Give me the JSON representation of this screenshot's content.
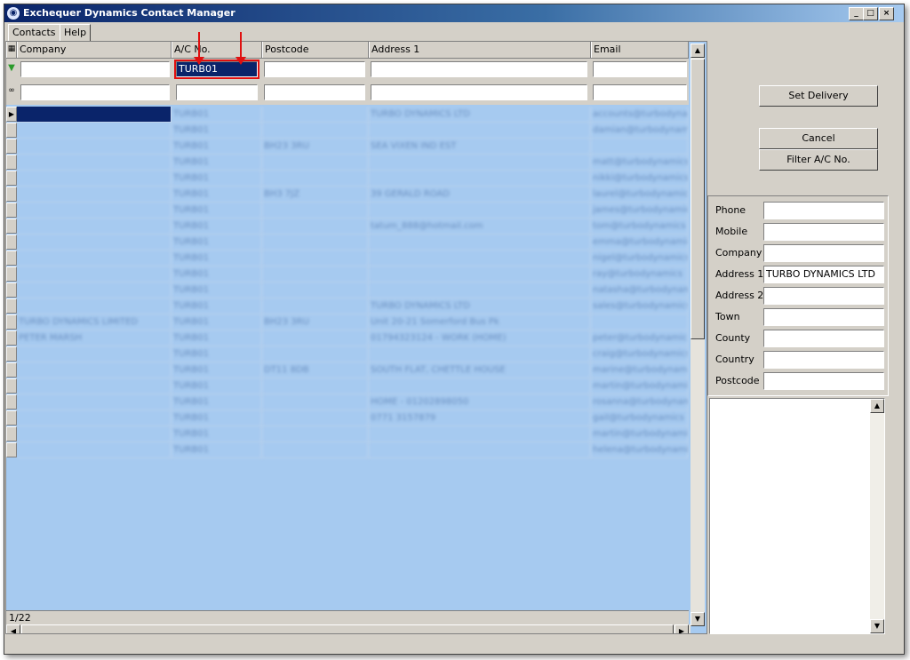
{
  "window": {
    "title": "Exchequer Dynamics Contact Manager",
    "min_glyph": "_",
    "max_glyph": "□",
    "close_glyph": "×"
  },
  "menu": {
    "tabs": [
      {
        "label": "Contacts"
      },
      {
        "label": "Help"
      }
    ]
  },
  "grid": {
    "columns": [
      {
        "label": "Company"
      },
      {
        "label": "A/C No."
      },
      {
        "label": "Postcode"
      },
      {
        "label": "Address 1"
      },
      {
        "label": "Email"
      }
    ],
    "filter_values": [
      "",
      "TURB01",
      "",
      "",
      ""
    ],
    "search_values": [
      "",
      "",
      "",
      "",
      ""
    ],
    "rows": [
      [
        "",
        "TURB01",
        "",
        "TURBO DYNAMICS LTD",
        "accounts@turbodynamics"
      ],
      [
        "",
        "TURB01",
        "",
        "",
        "damian@turbodynamics"
      ],
      [
        "",
        "TURB01",
        "BH23 3RU",
        "SEA VIXEN IND EST",
        ""
      ],
      [
        "",
        "TURB01",
        "",
        "",
        "matt@turbodynamics"
      ],
      [
        "",
        "TURB01",
        "",
        "",
        "nikki@turbodynamics"
      ],
      [
        "",
        "TURB01",
        "BH3 7JZ",
        "39 GERALD ROAD",
        "laurel@turbodynamics"
      ],
      [
        "",
        "TURB01",
        "",
        "",
        "james@turbodynamics"
      ],
      [
        "",
        "TURB01",
        "",
        "tatum_888@hotmail.com",
        "tom@turbodynamics"
      ],
      [
        "",
        "TURB01",
        "",
        "",
        "emma@turbodynamics"
      ],
      [
        "",
        "TURB01",
        "",
        "",
        "nigel@turbodynamics"
      ],
      [
        "",
        "TURB01",
        "",
        "",
        "ray@turbodynamics"
      ],
      [
        "",
        "TURB01",
        "",
        "",
        "natasha@turbodynamics"
      ],
      [
        "",
        "TURB01",
        "",
        "TURBO DYNAMICS LTD",
        "sales@turbodynamics"
      ],
      [
        "TURBO DYNAMICS LIMITED",
        "TURB01",
        "BH23 3RU",
        "Unit 20-21 Somerford Bus Pk",
        ""
      ],
      [
        "PETER MARSH",
        "TURB01",
        "",
        "01794323124 - WORK (HOME)",
        "peter@turbodynamics"
      ],
      [
        "",
        "TURB01",
        "",
        "",
        "craig@turbodynamics"
      ],
      [
        "",
        "TURB01",
        "DT11 8DB",
        "SOUTH FLAT, CHETTLE HOUSE",
        "marine@turbodynamics"
      ],
      [
        "",
        "TURB01",
        "",
        "",
        "martin@turbodynamics"
      ],
      [
        "",
        "TURB01",
        "",
        "HOME - 01202898050",
        "rosanna@turbodynamics"
      ],
      [
        "",
        "TURB01",
        "",
        "0771 3157879",
        "gail@turbodynamics"
      ],
      [
        "",
        "TURB01",
        "",
        "",
        "martin@turbodynamics"
      ],
      [
        "",
        "TURB01",
        "",
        "",
        "helena@turbodynamics"
      ]
    ]
  },
  "status": {
    "record": "1/22"
  },
  "buttons": {
    "set_delivery": "Set Delivery",
    "cancel": "Cancel",
    "filter_ac": "Filter A/C No."
  },
  "details": {
    "fields": [
      {
        "label": "Phone",
        "value": ""
      },
      {
        "label": "Mobile",
        "value": ""
      },
      {
        "label": "Company",
        "value": ""
      },
      {
        "label": "Address 1",
        "value": "TURBO DYNAMICS LTD"
      },
      {
        "label": "Address 2",
        "value": ""
      },
      {
        "label": "Town",
        "value": ""
      },
      {
        "label": "County",
        "value": ""
      },
      {
        "label": "Country",
        "value": ""
      },
      {
        "label": "Postcode",
        "value": ""
      }
    ]
  },
  "colors": {
    "selection": "#0a246a",
    "grid_background": "#a6caf0",
    "annotation": "#e01010"
  }
}
